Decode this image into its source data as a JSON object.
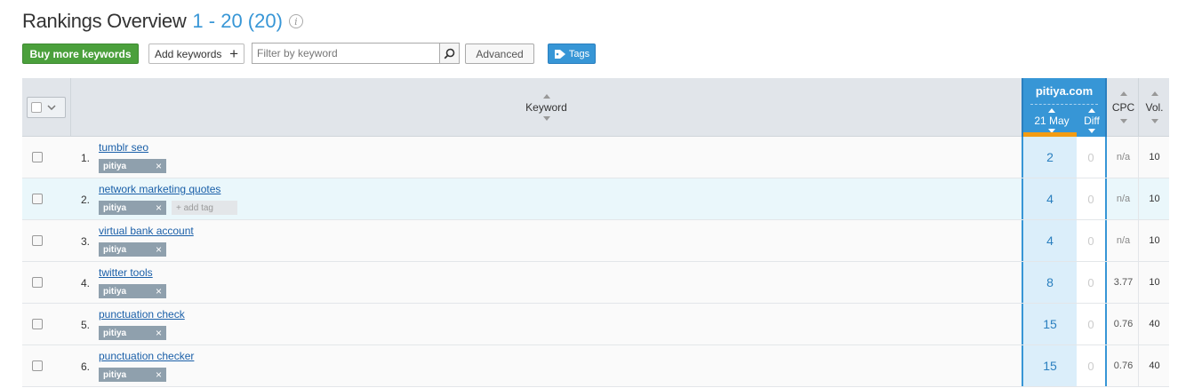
{
  "header": {
    "title": "Rankings Overview",
    "count": "1 - 20 (20)",
    "info_icon": "info-icon"
  },
  "toolbar": {
    "buy_label": "Buy more keywords",
    "add_label": "Add keywords",
    "filter_placeholder": "Filter by keyword",
    "advanced_label": "Advanced",
    "tags_label": "Tags"
  },
  "table": {
    "col_keyword": "Keyword",
    "domain": "pitiya.com",
    "col_date": "21 May",
    "col_diff": "Diff",
    "col_cpc": "CPC",
    "col_vol": "Vol.",
    "rows": [
      {
        "num": "1.",
        "keyword": "tumblr seo",
        "tag": "pitiya",
        "pos": "2",
        "diff": "0",
        "cpc": "n/a",
        "vol": "10"
      },
      {
        "num": "2.",
        "keyword": "network marketing quotes",
        "tag": "pitiya",
        "add_tag": "add tag",
        "pos": "4",
        "diff": "0",
        "cpc": "n/a",
        "vol": "10"
      },
      {
        "num": "3.",
        "keyword": "virtual bank account",
        "tag": "pitiya",
        "pos": "4",
        "diff": "0",
        "cpc": "n/a",
        "vol": "10"
      },
      {
        "num": "4.",
        "keyword": "twitter tools",
        "tag": "pitiya",
        "pos": "8",
        "diff": "0",
        "cpc": "3.77",
        "vol": "10"
      },
      {
        "num": "5.",
        "keyword": "punctuation check",
        "tag": "pitiya",
        "pos": "15",
        "diff": "0",
        "cpc": "0.76",
        "vol": "40"
      },
      {
        "num": "6.",
        "keyword": "punctuation checker",
        "tag": "pitiya",
        "pos": "15",
        "diff": "0",
        "cpc": "0.76",
        "vol": "40"
      }
    ]
  },
  "colors": {
    "accent_blue": "#3796d6",
    "button_green": "#4ba03c",
    "sort_orange": "#f39c12"
  }
}
